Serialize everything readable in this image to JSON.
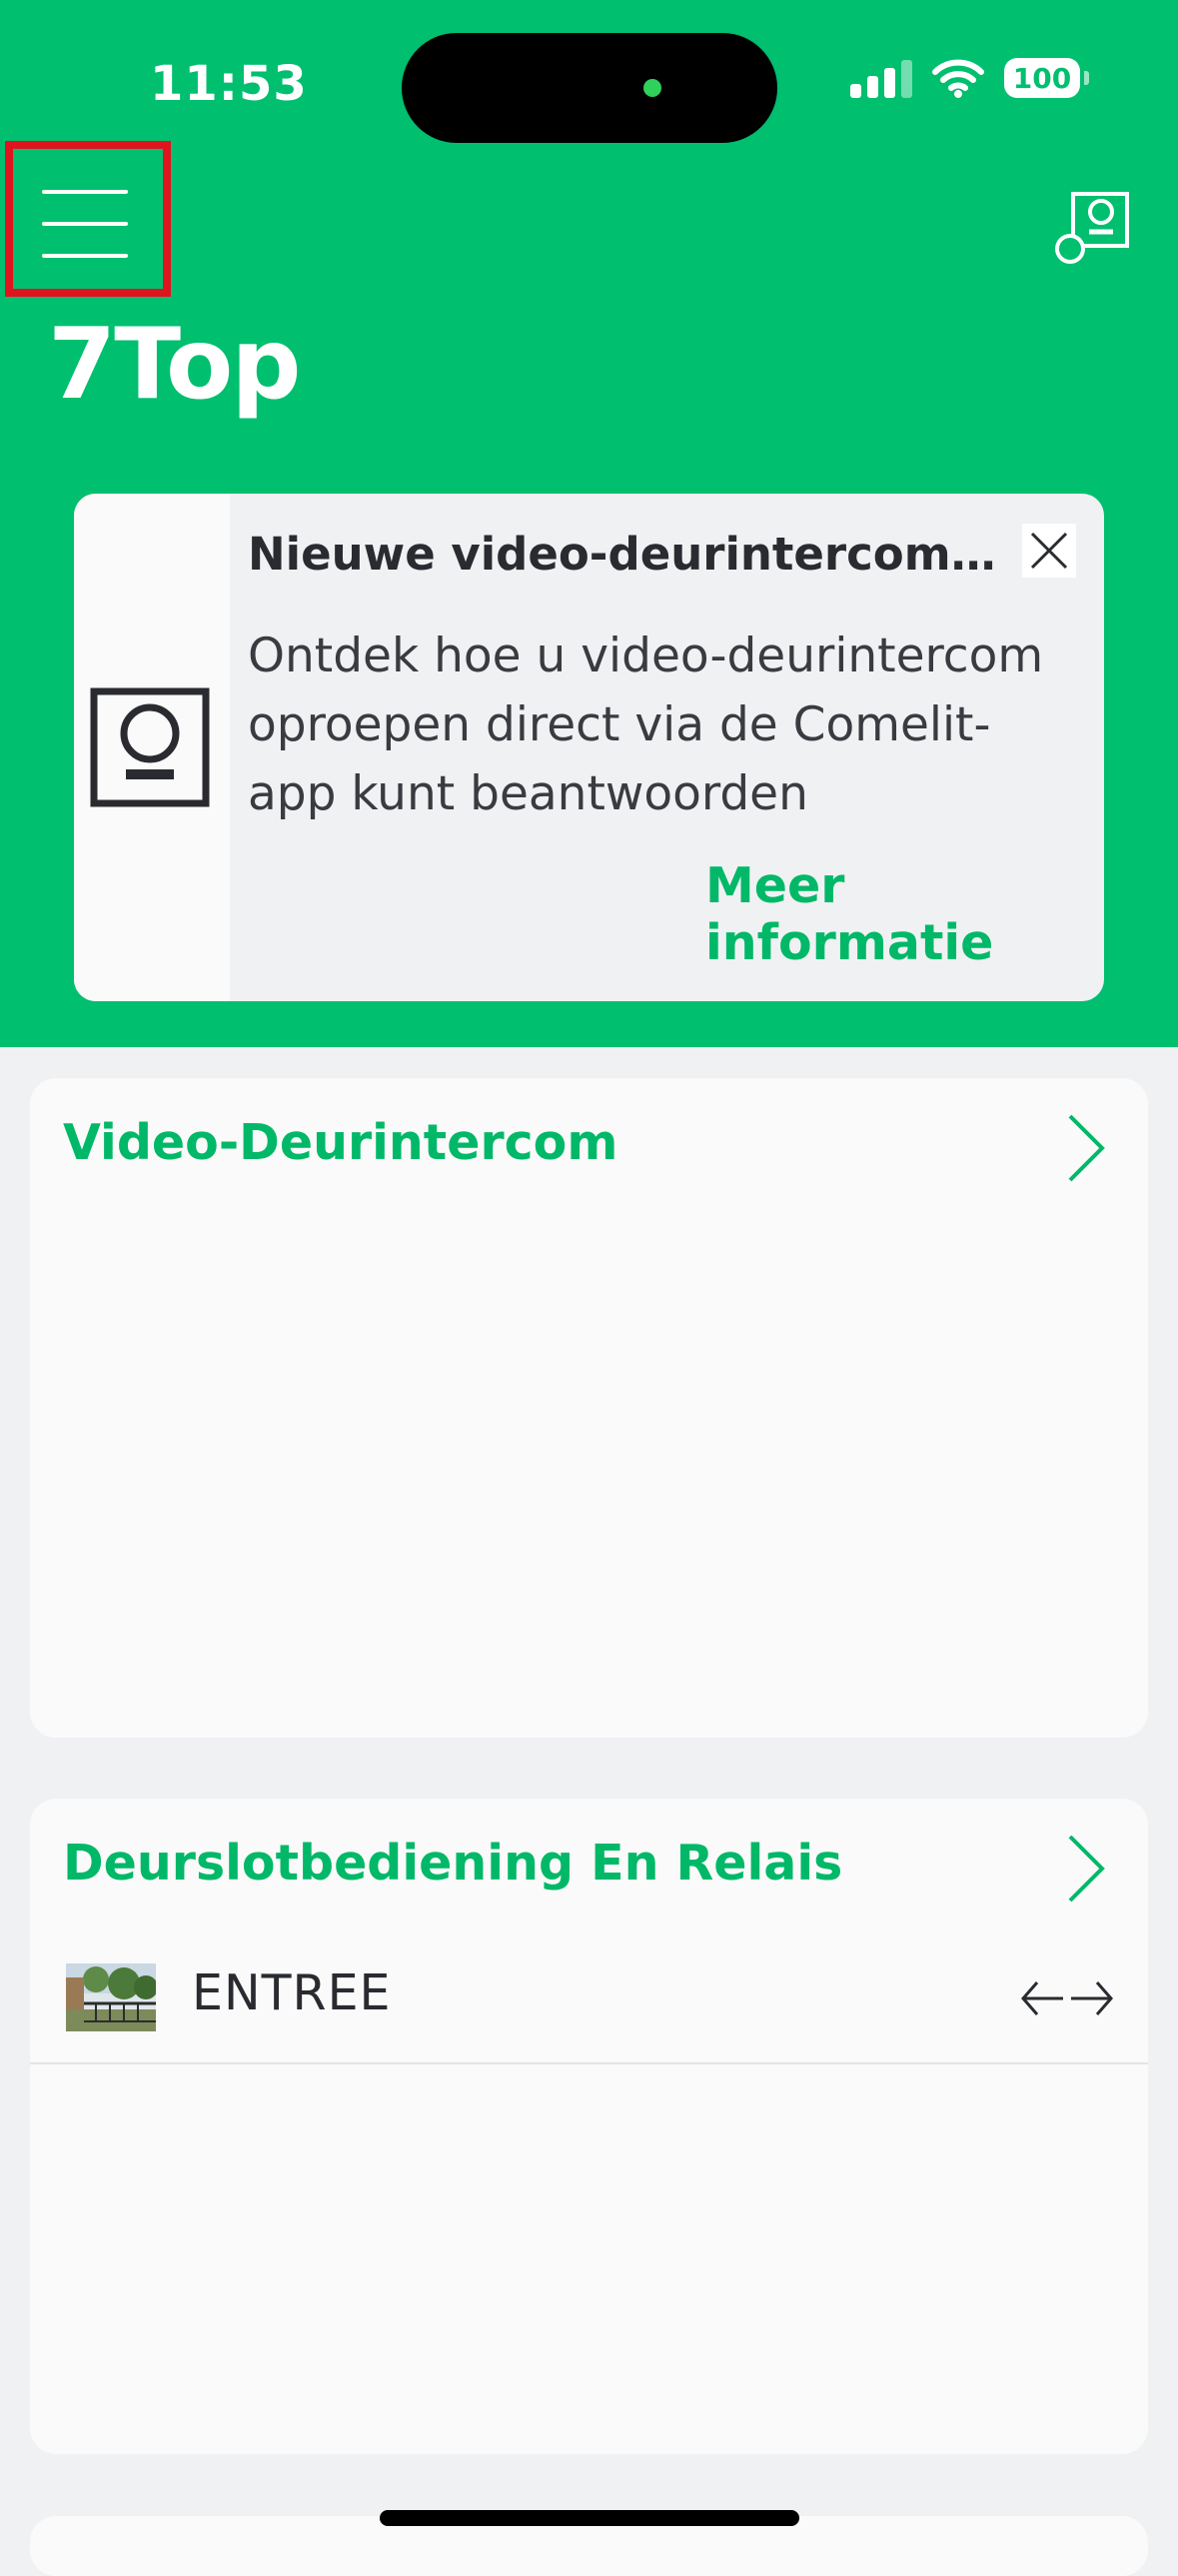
{
  "status_bar": {
    "time": "11:53",
    "battery": "100"
  },
  "header": {
    "title": "7Top",
    "menu_icon": "hamburger-menu-icon",
    "right_icon": "door-intercom-icon"
  },
  "promo": {
    "title": "Nieuwe video-deurintercom o...",
    "text": "Ontdek hoe u video-deurintercom oproepen direct via de Comelit-app kunt beantwoorden",
    "link": "Meer informatie",
    "icon": "video-intercom-icon",
    "close_icon": "close-icon"
  },
  "sections": {
    "video_intercom": {
      "title": "Video-Deurintercom"
    },
    "relays": {
      "title": "Deurslotbediening En Relais",
      "items": [
        {
          "label": "ENTREE",
          "icon": "gate-thumbnail",
          "action_icon": "open-close-arrows-icon"
        }
      ]
    }
  },
  "colors": {
    "brand_green": "#00bf6f",
    "accent_text": "#00b868",
    "background": "#f0f1f3"
  }
}
